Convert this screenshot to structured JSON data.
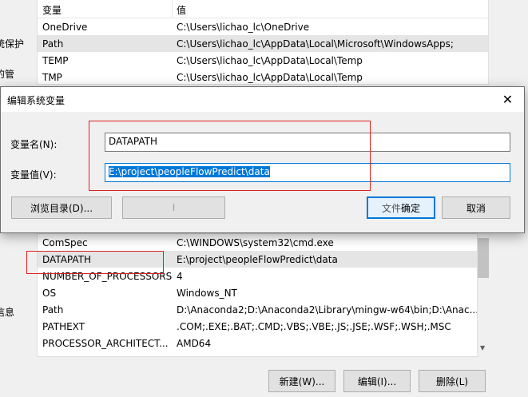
{
  "background": {
    "side_texts": [
      "统保护",
      "的管",
      "信息"
    ],
    "user_vars": {
      "header_name": "变量",
      "header_value": "值",
      "rows": [
        {
          "name": "OneDrive",
          "value": "C:\\Users\\lichao_lc\\OneDrive"
        },
        {
          "name": "Path",
          "value": "C:\\Users\\lichao_lc\\AppData\\Local\\Microsoft\\WindowsApps;"
        },
        {
          "name": "TEMP",
          "value": "C:\\Users\\lichao_lc\\AppData\\Local\\Temp"
        },
        {
          "name": "TMP",
          "value": "C:\\Users\\lichao_lc\\AppData\\Local\\Temp"
        }
      ]
    },
    "sys_vars": {
      "rows": [
        {
          "name": "ComSpec",
          "value": "C:\\WINDOWS\\system32\\cmd.exe"
        },
        {
          "name": "DATAPATH",
          "value": "E:\\project\\peopleFlowPredict\\data"
        },
        {
          "name": "NUMBER_OF_PROCESSORS",
          "value": "4"
        },
        {
          "name": "OS",
          "value": "Windows_NT"
        },
        {
          "name": "Path",
          "value": "D:\\Anaconda2;D:\\Anaconda2\\Library\\mingw-w64\\bin;D:\\Anac..."
        },
        {
          "name": "PATHEXT",
          "value": ".COM;.EXE;.BAT;.CMD;.VBS;.VBE;.JS;.JSE;.WSF;.WSH;.MSC"
        },
        {
          "name": "PROCESSOR_ARCHITECT...",
          "value": "AMD64"
        }
      ]
    },
    "buttons": {
      "new": "新建(W)...",
      "edit": "编辑(I)...",
      "delete": "删除(L)"
    }
  },
  "dialog": {
    "title": "编辑系统变量",
    "close_glyph": "✕",
    "name_label": "变量名(N):",
    "name_value": "DATAPATH",
    "value_label": "变量值(V):",
    "value_value": "E:\\project\\peopleFlowPredict\\data",
    "browse_button": "浏览目录(D)...",
    "middle_button": "I",
    "ok_button": "确定",
    "ok_overlap_text": "文件",
    "cancel_button": "取消"
  },
  "colors": {
    "accent": "#0078d7",
    "annotation_red": "#e02020"
  }
}
